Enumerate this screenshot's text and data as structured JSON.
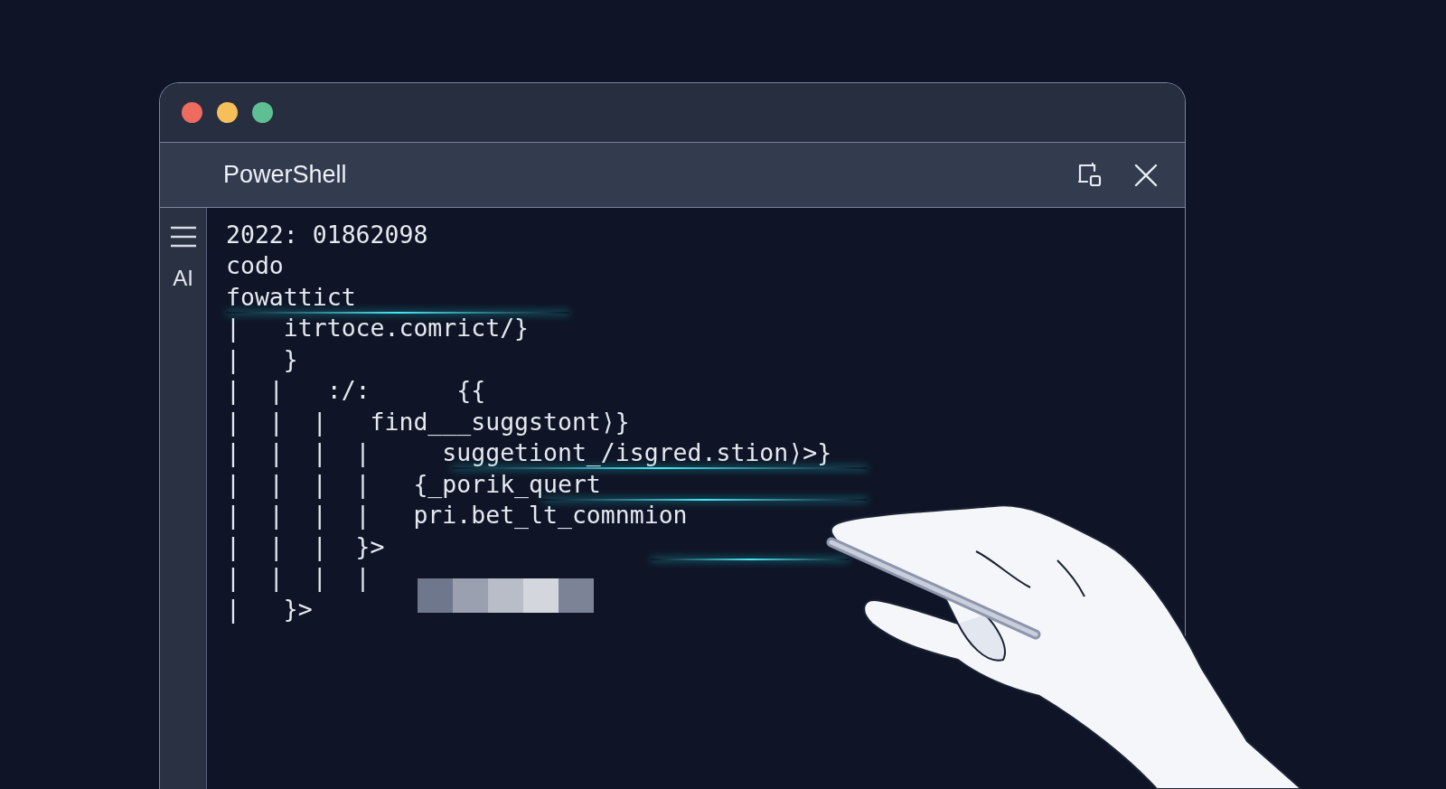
{
  "window": {
    "controls": [
      {
        "color": "#ee6b5f"
      },
      {
        "color": "#f6bf5a"
      },
      {
        "color": "#5fbf94"
      }
    ]
  },
  "tab": {
    "title": "PowerShell"
  },
  "sidebar": {
    "label": "AI"
  },
  "code_lines": [
    {
      "text": "2022: 01862098"
    },
    {
      "text": "codo"
    },
    {
      "text": "fowattict"
    },
    {
      "text": "|   itrtoce.comrict/}"
    },
    {
      "text": "|   }"
    },
    {
      "text": "|  |   :/:      {{"
    },
    {
      "text": "|  |  |   find___suggstont⟩}"
    },
    {
      "text": "|  |  |  |     suggetiont_/isgred.stion⟩>}"
    },
    {
      "text": "|  |  |  |   {_porik_quert"
    },
    {
      "text": "|  |  |  |   pri.bet_lt_comnmion"
    },
    {
      "text": "|  |  |  }>"
    },
    {
      "text": "|  |  |  |",
      "kind": "blocks"
    },
    {
      "text": "|   }>"
    }
  ]
}
